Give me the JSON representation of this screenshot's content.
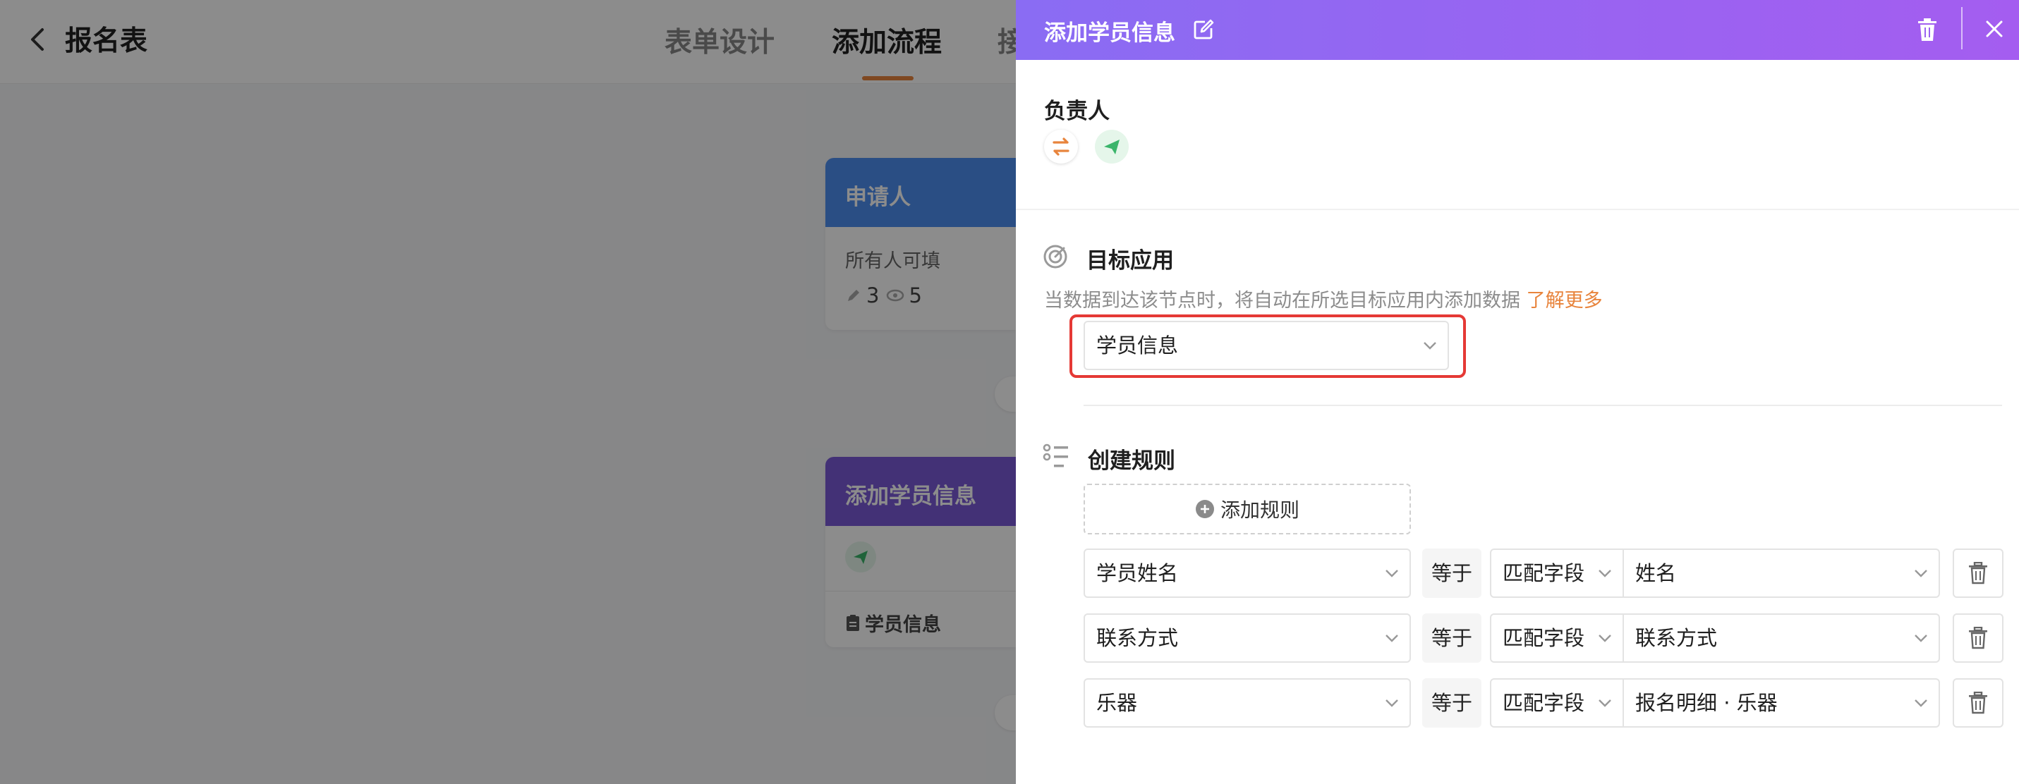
{
  "page": {
    "title": "报名表",
    "tabs": [
      {
        "label": "表单设计"
      },
      {
        "label": "添加流程"
      },
      {
        "label": "接"
      }
    ]
  },
  "flow": {
    "applicant_node": {
      "title": "申请人",
      "subtitle": "所有人可填",
      "edit_count": "3",
      "view_count": "5"
    },
    "add_node": {
      "title": "添加学员信息",
      "target": "学员信息"
    }
  },
  "drawer": {
    "title": "添加学员信息",
    "owner_label": "负责人",
    "target_section": {
      "label": "目标应用",
      "description": "当数据到达该节点时，将自动在所选目标应用内添加数据",
      "learn_more": "了解更多",
      "selected_app": "学员信息"
    },
    "rules_section": {
      "label": "创建规则",
      "add_button": "添加规则",
      "rules": [
        {
          "field": "学员姓名",
          "operator": "等于",
          "match_type": "匹配字段",
          "value": "姓名"
        },
        {
          "field": "联系方式",
          "operator": "等于",
          "match_type": "匹配字段",
          "value": "联系方式"
        },
        {
          "field": "乐器",
          "operator": "等于",
          "match_type": "匹配字段",
          "value": "报名明细 · 乐器"
        }
      ]
    }
  },
  "colors": {
    "header_gradient_start": "#8a6cf3",
    "header_gradient_end": "#a45df0",
    "accent_orange": "#e8843c",
    "highlight_red": "#e53935",
    "applicant_blue": "#4d8ef0",
    "add_node_purple": "#7a5ad8"
  },
  "icons": [
    "back-arrow-icon",
    "edit-icon",
    "trash-icon",
    "close-icon",
    "swap-icon",
    "send-icon",
    "target-icon",
    "list-icon",
    "plus-circle-icon",
    "chevron-down-icon",
    "pencil-icon",
    "eye-icon",
    "form-icon"
  ]
}
